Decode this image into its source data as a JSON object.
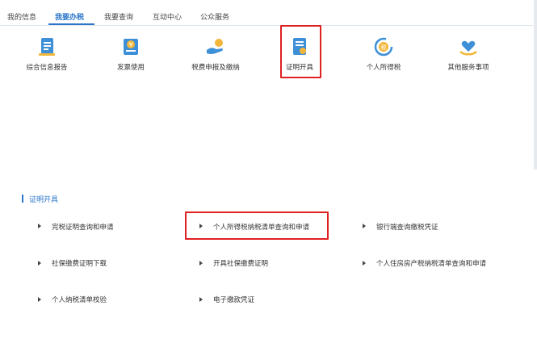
{
  "tabs": [
    {
      "label": "我的信息"
    },
    {
      "label": "我要办税"
    },
    {
      "label": "我要查询"
    },
    {
      "label": "互动中心"
    },
    {
      "label": "公众服务"
    }
  ],
  "active_tab": "我要办税",
  "tiles": [
    {
      "label": "综合信息报告",
      "icon": "report-icon"
    },
    {
      "label": "发票使用",
      "icon": "invoice-icon"
    },
    {
      "label": "税费申报及缴纳",
      "icon": "tax-payment-icon"
    },
    {
      "label": "证明开具",
      "icon": "certificate-icon"
    },
    {
      "label": "个人所得税",
      "icon": "personal-tax-icon"
    },
    {
      "label": "其他服务事项",
      "icon": "other-services-icon"
    }
  ],
  "section": {
    "title": "证明开具",
    "links": [
      {
        "label": "完税证明查询和申请"
      },
      {
        "label": "个人所得税纳税清单查询和申请"
      },
      {
        "label": "银行端查询缴税凭证"
      },
      {
        "label": "社保缴费证明下载"
      },
      {
        "label": "开具社保缴费证明"
      },
      {
        "label": "个人住房房产税纳税清单查询和申请"
      },
      {
        "label": "个人纳税清单校验"
      },
      {
        "label": "电子缴款凭证"
      }
    ]
  },
  "colors": {
    "accent": "#2a76c9",
    "highlight": "#e02020"
  }
}
